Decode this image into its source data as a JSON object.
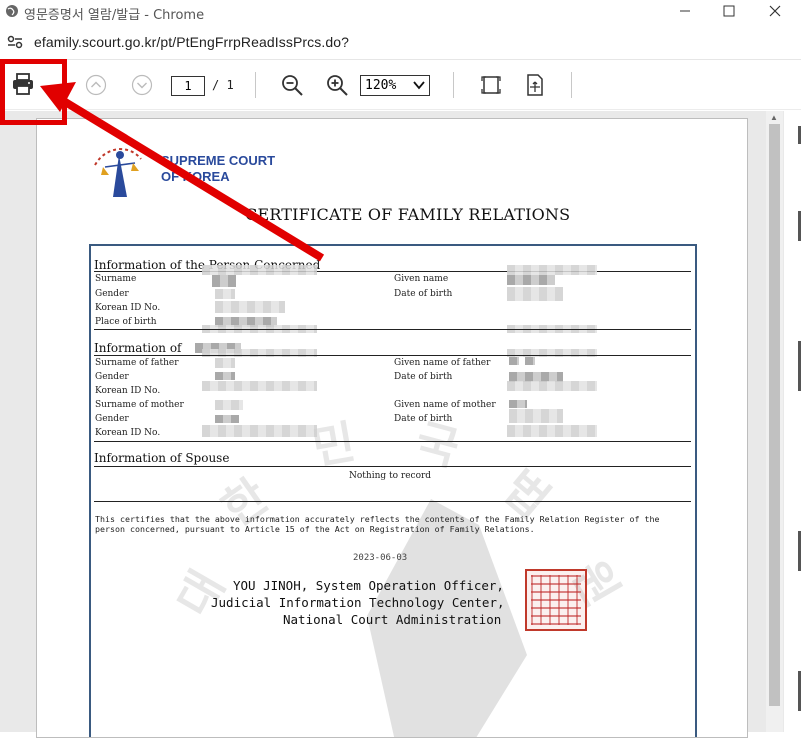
{
  "window": {
    "title": "영문증명서 열람/발급 - Chrome"
  },
  "address_bar": {
    "url": "efamily.scourt.go.kr/pt/PtEngFrrpReadIssPrcs.do?"
  },
  "pdf_toolbar": {
    "current_page": "1",
    "page_count": "/ 1",
    "zoom": "120%"
  },
  "document": {
    "logo_line1": "SUPREME COURT",
    "logo_line2": "OF KOREA",
    "title": "CERTIFICATE OF FAMILY RELATIONS",
    "section_person": "Information of the Person Concerned",
    "section_parents": "Information of",
    "section_spouse": "Information of Spouse",
    "labels": {
      "surname": "Surname",
      "given_name": "Given name",
      "gender": "Gender",
      "date_of_birth": "Date of birth",
      "korean_id": "Korean ID No.",
      "place_of_birth": "Place of birth",
      "surname_father": "Surname of father",
      "given_name_father": "Given name of father",
      "gender2": "Gender",
      "date_of_birth2": "Date of birth",
      "korean_id2": "Korean ID No.",
      "surname_mother": "Surname of mother",
      "given_name_mother": "Given name of mother",
      "gender3": "Gender",
      "date_of_birth3": "Date of birth",
      "korean_id3": "Korean ID No."
    },
    "nothing_to_record": "Nothing to record",
    "certify_text": "This certifies that the above information accurately reflects the contents of the Family Relation Register of the person concerned, pursuant to Article 15 of the Act on Registration of Family Relations.",
    "date": "2023-06-03",
    "official_line1": "YOU JINOH, System Operation Officer,",
    "official_line2": "Judicial Information Technology Center,",
    "official_line3": "National Court Administration"
  },
  "colors": {
    "highlight": "#e10000",
    "logo_blue": "#2a4a9c",
    "seal_red": "#c0392b"
  }
}
